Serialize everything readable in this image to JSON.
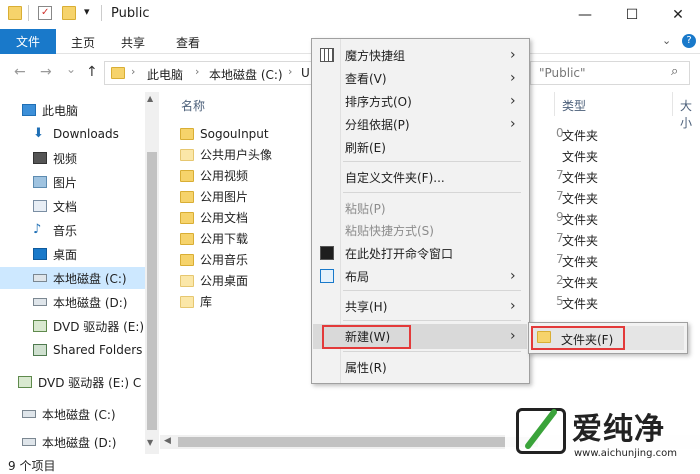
{
  "window": {
    "title": "Public",
    "qat_arrow": "▾",
    "controls": {
      "minimize": "—",
      "maximize": "☐",
      "close": "✕"
    }
  },
  "ribbon": {
    "file_tab": "文件",
    "tabs": [
      "主页",
      "共享",
      "查看"
    ],
    "collapse_icon": "chevron-down-icon",
    "help_icon": "help-icon"
  },
  "address": {
    "back": "←",
    "forward": "→",
    "recent": "⌄",
    "up": "↑",
    "crumbs": [
      "此电脑",
      "本地磁盘 (C:)",
      "U"
    ],
    "search_fragment": "\"Public\""
  },
  "nav": {
    "items": [
      {
        "label": "此电脑",
        "icon": "pc-icon"
      },
      {
        "label": "Downloads",
        "icon": "downloads-icon"
      },
      {
        "label": "视频",
        "icon": "video-icon"
      },
      {
        "label": "图片",
        "icon": "pictures-icon"
      },
      {
        "label": "文档",
        "icon": "documents-icon"
      },
      {
        "label": "音乐",
        "icon": "music-icon"
      },
      {
        "label": "桌面",
        "icon": "desktop-icon"
      },
      {
        "label": "本地磁盘 (C:)",
        "icon": "drive-icon"
      },
      {
        "label": "本地磁盘 (D:)",
        "icon": "drive-icon"
      },
      {
        "label": "DVD 驱动器 (E:)",
        "icon": "dvd-icon"
      },
      {
        "label": "Shared Folders",
        "icon": "network-drive-icon"
      },
      {
        "label": "DVD 驱动器 (E:) C",
        "icon": "dvd-icon"
      },
      {
        "label": "本地磁盘 (C:)",
        "icon": "drive-icon"
      },
      {
        "label": "本地磁盘 (D:)",
        "icon": "drive-icon"
      }
    ]
  },
  "content": {
    "headers": {
      "name": "名称",
      "type": "类型",
      "size": "大小"
    },
    "files": [
      {
        "name": "SogouInput",
        "type": "文件夹",
        "date_frag": "0"
      },
      {
        "name": "公共用户头像",
        "type": "文件夹",
        "date_frag": ""
      },
      {
        "name": "公用视频",
        "type": "文件夹",
        "date_frag": "7"
      },
      {
        "name": "公用图片",
        "type": "文件夹",
        "date_frag": "7"
      },
      {
        "name": "公用文档",
        "type": "文件夹",
        "date_frag": "9"
      },
      {
        "name": "公用下载",
        "type": "文件夹",
        "date_frag": "7"
      },
      {
        "name": "公用音乐",
        "type": "文件夹",
        "date_frag": "7"
      },
      {
        "name": "公用桌面",
        "type": "文件夹",
        "date_frag": "2"
      },
      {
        "name": "库",
        "type": "文件夹",
        "date_frag": "5"
      }
    ]
  },
  "context_menu": {
    "items": [
      {
        "label": "魔方快捷组",
        "submenu": true,
        "icon": "grid-icon"
      },
      {
        "label": "查看(V)",
        "submenu": true
      },
      {
        "label": "排序方式(O)",
        "submenu": true
      },
      {
        "label": "分组依据(P)",
        "submenu": true
      },
      {
        "label": "刷新(E)"
      },
      {
        "label": "自定义文件夹(F)..."
      },
      {
        "label": "粘贴(P)",
        "disabled": true
      },
      {
        "label": "粘贴快捷方式(S)",
        "disabled": true
      },
      {
        "label": "在此处打开命令窗口",
        "icon": "cmd-icon"
      },
      {
        "label": "布局",
        "submenu": true,
        "icon": "layout-icon"
      },
      {
        "label": "共享(H)",
        "submenu": true
      },
      {
        "label": "新建(W)",
        "submenu": true
      },
      {
        "label": "属性(R)"
      }
    ],
    "submenu_new": {
      "label": "文件夹(F)"
    }
  },
  "status": {
    "item_count": "9 个项目"
  },
  "watermark": {
    "brand": "爱纯净",
    "url": "www.aichunjing.com"
  },
  "colors": {
    "accent": "#1979ca",
    "highlight_red": "#e33a3a",
    "selected": "#cde8ff"
  }
}
